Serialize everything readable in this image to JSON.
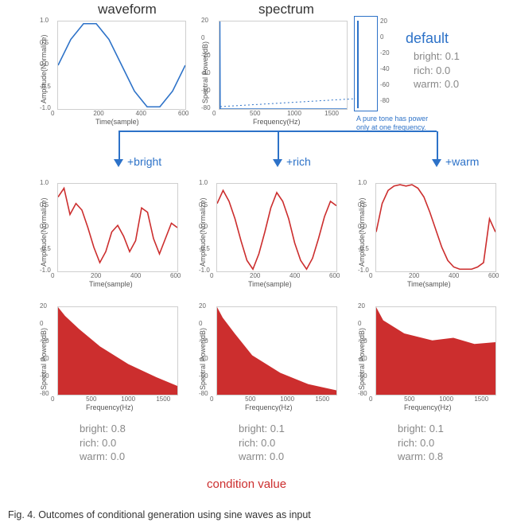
{
  "titles": {
    "waveform": "waveform",
    "spectrum": "spectrum",
    "default": "default"
  },
  "axis": {
    "xTime": "Time(sample)",
    "yAmp": "Amplitude(Normalize)",
    "xFreq": "Frequency(Hz)",
    "yPow": "Spectral Power(dB)",
    "timeTicks": [
      "0",
      "200",
      "400",
      "600"
    ],
    "ampTicks": [
      "-1.0",
      "-0.5",
      "0.0",
      "0.5",
      "1.0"
    ],
    "freqTicks": [
      "0",
      "500",
      "1000",
      "1500"
    ],
    "powTicks": [
      "-80",
      "-60",
      "-40",
      "-20",
      "0",
      "20"
    ]
  },
  "defaultCond": {
    "bright": "bright: 0.1",
    "rich": "rich: 0.0",
    "warm": "warm: 0.0"
  },
  "note": {
    "line1": "A pure tone has power",
    "line2": "only at one frequency."
  },
  "variants": {
    "bright": {
      "label": "+bright",
      "cond": {
        "bright": "bright: 0.8",
        "rich": "rich: 0.0",
        "warm": "warm: 0.0"
      }
    },
    "rich": {
      "label": "+rich",
      "cond": {
        "bright": "bright: 0.1",
        "rich": "rich: 0.0",
        "warm": "warm: 0.0"
      }
    },
    "warm": {
      "label": "+warm",
      "cond": {
        "bright": "bright: 0.1",
        "rich": "rich: 0.0",
        "warm": "warm: 0.8"
      }
    }
  },
  "condValueLabel": "condition value",
  "caption": "Fig.  4.     Outcomes  of  conditional  generation  using  sine  waves  as  input",
  "chart_data": [
    {
      "id": "default_waveform",
      "type": "line",
      "title": "waveform (default)",
      "xlabel": "Time(sample)",
      "ylabel": "Amplitude(Normalize)",
      "xlim": [
        0,
        600
      ],
      "ylim": [
        -1.0,
        1.0
      ],
      "series": [
        {
          "name": "sine",
          "color": "#2d72c8",
          "x": [
            0,
            60,
            120,
            180,
            240,
            300,
            360,
            420,
            480,
            540,
            600
          ],
          "values": [
            0.0,
            0.59,
            0.95,
            0.95,
            0.59,
            0.0,
            -0.59,
            -0.95,
            -0.95,
            -0.59,
            0.0
          ]
        }
      ]
    },
    {
      "id": "default_spectrum",
      "type": "line",
      "title": "spectrum (default)",
      "xlabel": "Frequency(Hz)",
      "ylabel": "Spectral Power(dB)",
      "xlim": [
        0,
        1700
      ],
      "ylim": [
        -80,
        20
      ],
      "series": [
        {
          "name": "power",
          "color": "#2d72c8",
          "x": [
            0,
            4,
            8,
            1700
          ],
          "values": [
            -80,
            20,
            -80,
            -80
          ]
        }
      ]
    },
    {
      "id": "bright_waveform",
      "type": "line",
      "xlabel": "Time(sample)",
      "ylabel": "Amplitude(Normalize)",
      "xlim": [
        0,
        600
      ],
      "ylim": [
        -1.0,
        1.0
      ],
      "series": [
        {
          "name": "wave",
          "color": "#cc2e2e",
          "x": [
            0,
            30,
            60,
            90,
            120,
            150,
            180,
            210,
            240,
            270,
            300,
            330,
            360,
            390,
            420,
            450,
            480,
            510,
            540,
            570,
            600
          ],
          "values": [
            0.7,
            0.9,
            0.3,
            0.55,
            0.4,
            0.0,
            -0.45,
            -0.8,
            -0.55,
            -0.1,
            0.05,
            -0.2,
            -0.55,
            -0.3,
            0.45,
            0.35,
            -0.25,
            -0.6,
            -0.25,
            0.1,
            0.0
          ]
        }
      ]
    },
    {
      "id": "rich_waveform",
      "type": "line",
      "xlabel": "Time(sample)",
      "ylabel": "Amplitude(Normalize)",
      "xlim": [
        0,
        600
      ],
      "ylim": [
        -1.0,
        1.0
      ],
      "series": [
        {
          "name": "wave",
          "color": "#cc2e2e",
          "x": [
            0,
            30,
            60,
            90,
            120,
            150,
            180,
            210,
            240,
            270,
            300,
            330,
            360,
            390,
            420,
            450,
            480,
            510,
            540,
            570,
            600
          ],
          "values": [
            0.55,
            0.85,
            0.6,
            0.2,
            -0.3,
            -0.75,
            -0.95,
            -0.6,
            -0.1,
            0.45,
            0.8,
            0.6,
            0.2,
            -0.35,
            -0.75,
            -0.95,
            -0.7,
            -0.25,
            0.25,
            0.6,
            0.5
          ]
        }
      ]
    },
    {
      "id": "warm_waveform",
      "type": "line",
      "xlabel": "Time(sample)",
      "ylabel": "Amplitude(Normalize)",
      "xlim": [
        0,
        600
      ],
      "ylim": [
        -1.0,
        1.0
      ],
      "series": [
        {
          "name": "wave",
          "color": "#cc2e2e",
          "x": [
            0,
            30,
            60,
            90,
            120,
            150,
            180,
            210,
            240,
            270,
            300,
            330,
            360,
            390,
            420,
            450,
            480,
            510,
            540,
            570,
            600
          ],
          "values": [
            -0.1,
            0.55,
            0.85,
            0.95,
            0.98,
            0.95,
            0.98,
            0.9,
            0.7,
            0.35,
            -0.05,
            -0.45,
            -0.75,
            -0.9,
            -0.95,
            -0.95,
            -0.95,
            -0.9,
            -0.8,
            0.2,
            -0.1
          ]
        }
      ]
    },
    {
      "id": "bright_spectrum",
      "type": "area",
      "xlabel": "Frequency(Hz)",
      "ylabel": "Spectral Power(dB)",
      "xlim": [
        0,
        1700
      ],
      "ylim": [
        -80,
        20
      ],
      "series": [
        {
          "name": "power",
          "color": "#cc2e2e",
          "x": [
            0,
            100,
            300,
            600,
            1000,
            1400,
            1700
          ],
          "values": [
            20,
            10,
            -5,
            -25,
            -45,
            -60,
            -70
          ]
        }
      ]
    },
    {
      "id": "rich_spectrum",
      "type": "area",
      "xlabel": "Frequency(Hz)",
      "ylabel": "Spectral Power(dB)",
      "xlim": [
        0,
        1700
      ],
      "ylim": [
        -80,
        20
      ],
      "series": [
        {
          "name": "power",
          "color": "#cc2e2e",
          "x": [
            0,
            80,
            250,
            500,
            900,
            1300,
            1700
          ],
          "values": [
            20,
            8,
            -10,
            -35,
            -55,
            -68,
            -75
          ]
        }
      ]
    },
    {
      "id": "warm_spectrum",
      "type": "area",
      "xlabel": "Frequency(Hz)",
      "ylabel": "Spectral Power(dB)",
      "xlim": [
        0,
        1700
      ],
      "ylim": [
        -80,
        20
      ],
      "series": [
        {
          "name": "power",
          "color": "#cc2e2e",
          "x": [
            0,
            100,
            400,
            800,
            1100,
            1400,
            1700
          ],
          "values": [
            20,
            5,
            -10,
            -18,
            -15,
            -22,
            -20
          ]
        }
      ]
    }
  ]
}
